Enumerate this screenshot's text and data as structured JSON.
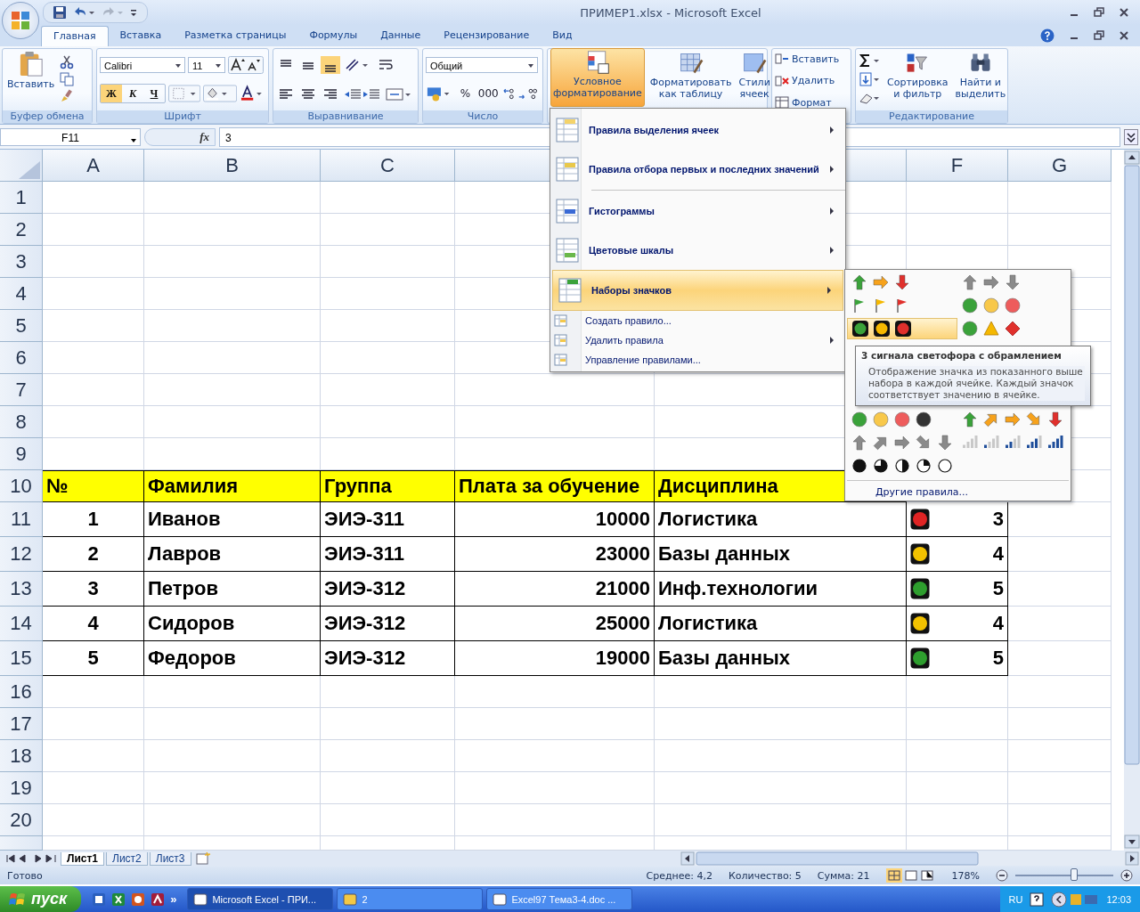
{
  "window": {
    "title": "ПРИМЕР1.xlsx - Microsoft Excel"
  },
  "tabs": [
    {
      "label": "Главная",
      "selected": true
    },
    {
      "label": "Вставка",
      "selected": false
    },
    {
      "label": "Разметка страницы",
      "selected": false
    },
    {
      "label": "Формулы",
      "selected": false
    },
    {
      "label": "Данные",
      "selected": false
    },
    {
      "label": "Рецензирование",
      "selected": false
    },
    {
      "label": "Вид",
      "selected": false
    }
  ],
  "clipboard": {
    "paste": "Вставить",
    "label": "Буфер обмена"
  },
  "font": {
    "name": "Calibri",
    "size": "11",
    "bold": {
      "label": "Ж",
      "on": true
    },
    "italic": {
      "label": "К",
      "on": false
    },
    "underline": {
      "label": "Ч",
      "on": false
    },
    "label": "Шрифт"
  },
  "alignment": {
    "label": "Выравнивание"
  },
  "number": {
    "format": "Общий",
    "percent": "%",
    "thousands": "000",
    "label": "Число"
  },
  "styles": {
    "conditional": {
      "lines": [
        "Условное",
        "форматирование"
      ],
      "on": true
    },
    "as_table": [
      "Форматировать",
      "как таблицу"
    ],
    "cell_styles": [
      "Стили",
      "ячеек"
    ]
  },
  "cells": {
    "insert": "Вставить",
    "delete": "Удалить",
    "format": "Формат"
  },
  "editing": {
    "sort": [
      "Сортировка",
      "и фильтр"
    ],
    "find": [
      "Найти и",
      "выделить"
    ],
    "label": "Редактирование"
  },
  "formula_bar": {
    "name_box": "F11",
    "fx": "fx",
    "value": "3"
  },
  "columns": [
    {
      "letter": "A"
    },
    {
      "letter": "B"
    },
    {
      "letter": "C"
    },
    {},
    {},
    {
      "letter": "F"
    },
    {
      "letter": "G"
    }
  ],
  "row_numbers": [
    "1",
    "2",
    "3",
    "4",
    "5",
    "6",
    "7",
    "8",
    "9",
    "10",
    "11",
    "12",
    "13",
    "14",
    "15",
    "16",
    "17",
    "18",
    "19",
    "20"
  ],
  "table": {
    "header": [
      "№",
      "Фамилия",
      "Группа",
      "Плата за обучение",
      "Дисциплина"
    ],
    "rows": [
      {
        "cells": [
          "1",
          "Иванов",
          "ЭИЭ-311",
          "10000",
          "Логистика"
        ],
        "color": "#e02424",
        "score": "3"
      },
      {
        "cells": [
          "2",
          "Лавров",
          "ЭИЭ-311",
          "23000",
          "Базы данных"
        ],
        "color": "#f2c200",
        "score": "4"
      },
      {
        "cells": [
          "3",
          "Петров",
          "ЭИЭ-312",
          "21000",
          "Инф.технологии"
        ],
        "color": "#2e9e2e",
        "score": "5"
      },
      {
        "cells": [
          "4",
          "Сидоров",
          "ЭИЭ-312",
          "25000",
          "Логистика"
        ],
        "color": "#f2c200",
        "score": "4"
      },
      {
        "cells": [
          "5",
          "Федоров",
          "ЭИЭ-312",
          "19000",
          "Базы данных"
        ],
        "color": "#2e9e2e",
        "score": "5"
      }
    ]
  },
  "menu": {
    "items": [
      {
        "label": "Правила выделения ячеек",
        "kind": "large",
        "submenu": true,
        "selected": false
      },
      {
        "label": "Правила отбора первых и последних значений",
        "kind": "large",
        "submenu": true,
        "selected": false
      },
      {
        "label": "Гистограммы",
        "kind": "large",
        "submenu": true,
        "selected": false
      },
      {
        "label": "Цветовые шкалы",
        "kind": "large",
        "submenu": true,
        "selected": false
      },
      {
        "label": "Наборы значков",
        "kind": "large",
        "submenu": true,
        "selected": true
      },
      {
        "label": "Создать правило...",
        "kind": "small",
        "submenu": false,
        "selected": false
      },
      {
        "label": "Удалить правила",
        "kind": "small",
        "submenu": true,
        "selected": false
      },
      {
        "label": "Управление правилами...",
        "kind": "small",
        "submenu": false,
        "selected": false
      }
    ]
  },
  "icon_sets": [
    {
      "kind": "arrows-color",
      "selected": false
    },
    {
      "kind": "arrows-gray",
      "selected": false
    },
    {
      "kind": "flags",
      "selected": false
    },
    {
      "kind": "circles",
      "selected": false
    },
    {
      "kind": "traffic-rimmed",
      "selected": true
    },
    {
      "kind": "shapes",
      "selected": false
    },
    {
      "kind": "circles4",
      "selected": false
    },
    {
      "kind": "arrows5-color",
      "selected": false
    },
    {
      "kind": "arrows5-gray",
      "selected": false
    },
    {
      "kind": "bars",
      "selected": false
    },
    {
      "kind": "quarters",
      "selected": false
    }
  ],
  "submenu_footer": "Другие правила...",
  "tooltip": {
    "title": "3 сигнала светофора с обрамлением",
    "body": "Отображение значка из показанного выше набора в каждой ячейке. Каждый значок соответствует значению в ячейке."
  },
  "sheets": [
    {
      "label": "Лист1",
      "selected": true
    },
    {
      "label": "Лист2",
      "selected": false
    },
    {
      "label": "Лист3",
      "selected": false
    }
  ],
  "status": {
    "ready": "Готово",
    "average": "Среднее: 4,2",
    "count": "Количество: 5",
    "sum": "Сумма: 21",
    "zoom": "178%",
    "zoom_slider": {
      "level": 0.6
    }
  },
  "taskbar": {
    "start": "пуск",
    "more": "»",
    "tasks": [
      {
        "label": "Microsoft Excel - ПРИ...",
        "selected": true
      },
      {
        "label": "2",
        "selected": false
      },
      {
        "label": "Excel97 Тема3-4.doc ...",
        "selected": false
      }
    ],
    "lang": "RU",
    "time": "12:03"
  }
}
